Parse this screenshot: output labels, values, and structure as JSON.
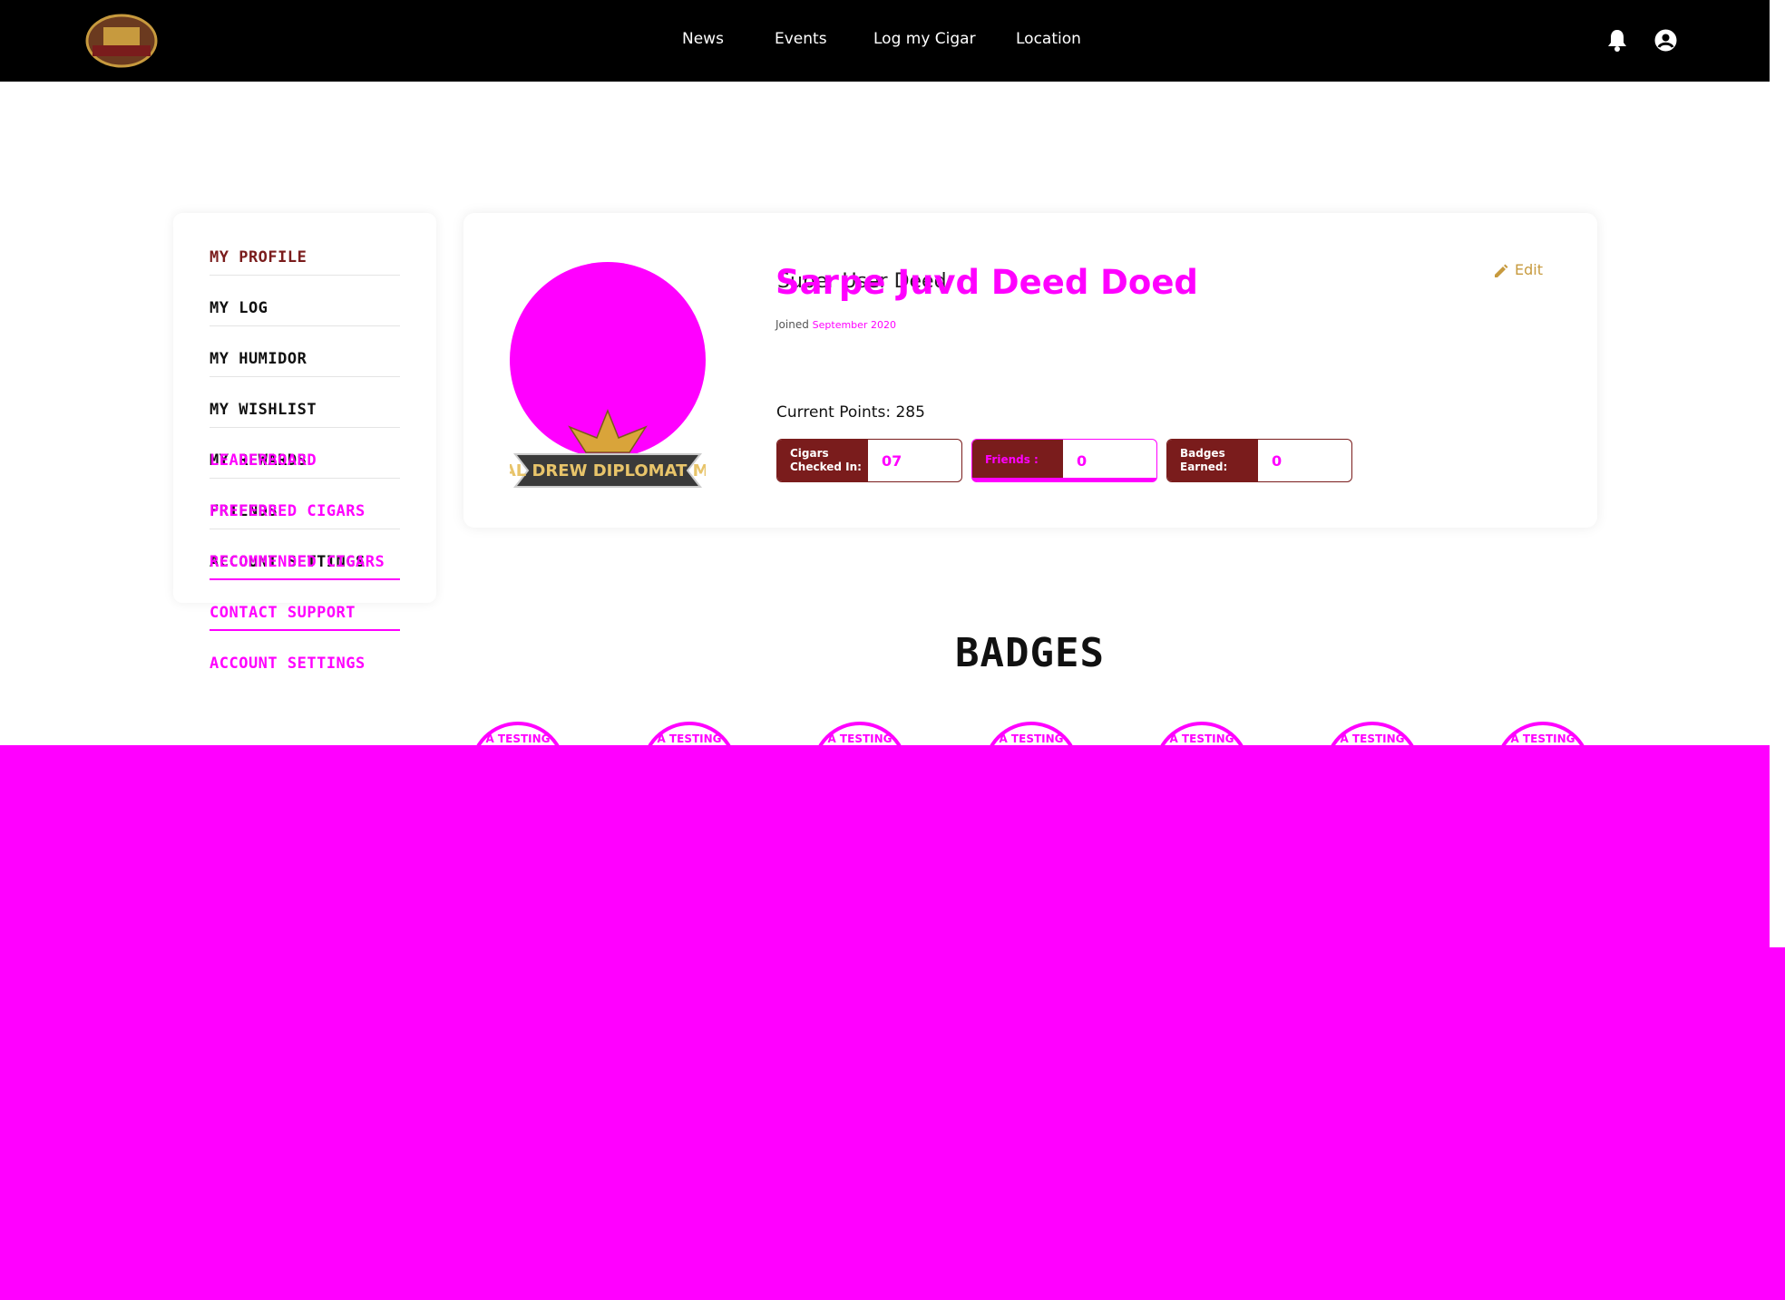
{
  "brand": {
    "logo_text": "DREW DIPLOMAT"
  },
  "nav": {
    "links": [
      "News",
      "Events",
      "Log my Cigar",
      "Location"
    ],
    "icons": [
      "bell-icon",
      "user-account-icon"
    ]
  },
  "sidebar": {
    "items": [
      {
        "label": "MY PROFILE"
      },
      {
        "label": "MY LOG"
      },
      {
        "label": "MY HUMIDOR"
      },
      {
        "label": "MY WISHLIST"
      },
      {
        "label": "MY REWARDS",
        "overlay": "LEADERBOARD"
      },
      {
        "label": "FRIENDS",
        "overlay": "PREFERRED CIGARS"
      },
      {
        "label": "ACCOUNT SETTINGS",
        "overlay": "RECOMMENDED CIGARS"
      },
      {
        "label": "CONTACT SUPPORT"
      },
      {
        "label": "ACCOUNT SETTINGS"
      }
    ]
  },
  "profile": {
    "name": "Sarpe Juvd Deed Doed",
    "name_under": "Super User Deed",
    "joined_label": "Joined",
    "joined_date": "September 2020",
    "edit_label": "Edit",
    "points_label": "Current Points: 285",
    "emblem_text": "OFFICIAL DREW DIPLOMAT MEMBER"
  },
  "stats": [
    {
      "label": "Cigars Checked In:",
      "value": "07"
    },
    {
      "label": "Friends :",
      "value": "0"
    },
    {
      "label": "Badges Earned:",
      "value": "0"
    }
  ],
  "badges": {
    "title": "BADGES",
    "items": [
      "A TESTING",
      "A TESTING",
      "A TESTING",
      "A TESTING",
      "A TESTING",
      "A TESTING",
      "A TESTING"
    ]
  },
  "colors": {
    "accent": "#7a1c1c",
    "gold": "#c79a3e",
    "placeholder_magenta": "#ff00ff",
    "nav_bg": "#000000"
  }
}
